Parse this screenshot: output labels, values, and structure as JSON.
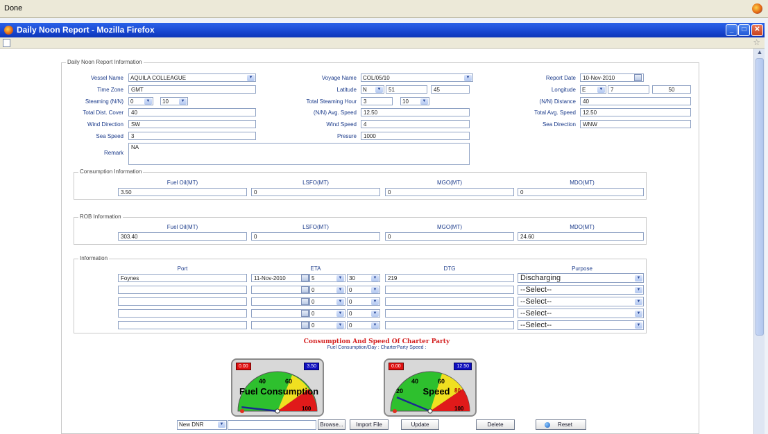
{
  "status": {
    "text": "Done"
  },
  "window": {
    "title": "Daily Noon Report - Mozilla Firefox"
  },
  "form": {
    "section_title": "Daily Noon Report Information",
    "vessel_name": {
      "label": "Vessel Name",
      "value": "AQUILA COLLEAGUE"
    },
    "voyage_name": {
      "label": "Voyage Name",
      "value": "COL/05/10"
    },
    "report_date": {
      "label": "Report Date",
      "value": "10-Nov-2010"
    },
    "time_zone": {
      "label": "Time Zone",
      "value": "GMT"
    },
    "latitude": {
      "label": "Latitude",
      "dir": "N",
      "deg": "51",
      "min": "45"
    },
    "longitude": {
      "label": "Longitude",
      "dir": "E",
      "deg": "7",
      "min": "50"
    },
    "steaming": {
      "label": "Steaming (N/N)",
      "h": "0",
      "m": "10"
    },
    "total_steaming_hour": {
      "label": "Total Steaming Hour",
      "h": "3",
      "m": "10"
    },
    "nn_distance": {
      "label": "(N/N) Distance",
      "value": "40"
    },
    "total_dist_cover": {
      "label": "Total Dist. Cover",
      "value": "40"
    },
    "nn_avg_speed": {
      "label": "(N/N) Avg. Speed",
      "value": "12.50"
    },
    "total_avg_speed": {
      "label": "Total Avg. Speed",
      "value": "12.50"
    },
    "wind_direction": {
      "label": "Wind Direction",
      "value": "SW"
    },
    "wind_speed": {
      "label": "Wind Speed",
      "value": "4"
    },
    "sea_direction": {
      "label": "Sea Direction",
      "value": "WNW"
    },
    "sea_speed": {
      "label": "Sea Speed",
      "value": "3"
    },
    "presure": {
      "label": "Presure",
      "value": "1000"
    },
    "remark": {
      "label": "Remark",
      "value": "NA"
    }
  },
  "consumption": {
    "legend": "Consumption Information",
    "cols": [
      "Fuel Oil(MT)",
      "LSFO(MT)",
      "MGO(MT)",
      "MDO(MT)"
    ],
    "values": [
      "3.50",
      "0",
      "0",
      "0"
    ]
  },
  "rob": {
    "legend": "ROB Information",
    "cols": [
      "Fuel Oil(MT)",
      "LSFO(MT)",
      "MGO(MT)",
      "MDO(MT)"
    ],
    "values": [
      "303.40",
      "0",
      "0",
      "24.60"
    ]
  },
  "info": {
    "legend": "Information",
    "cols": [
      "Port",
      "ETA",
      "DTG",
      "Purpose"
    ],
    "rows": [
      {
        "port": "Foynes",
        "date": "11-Nov-2010",
        "h": "5",
        "m": "30",
        "dtg": "219",
        "purpose": "Discharging"
      },
      {
        "port": "",
        "date": "",
        "h": "0",
        "m": "0",
        "dtg": "",
        "purpose": "--Select--"
      },
      {
        "port": "",
        "date": "",
        "h": "0",
        "m": "0",
        "dtg": "",
        "purpose": "--Select--"
      },
      {
        "port": "",
        "date": "",
        "h": "0",
        "m": "0",
        "dtg": "",
        "purpose": "--Select--"
      },
      {
        "port": "",
        "date": "",
        "h": "0",
        "m": "0",
        "dtg": "",
        "purpose": "--Select--"
      }
    ]
  },
  "charter": {
    "title": "Consumption And Speed Of Charter Party",
    "subtitle": "Fuel Consumption/Day :   CharterParty Speed :",
    "gauges": [
      {
        "label": "Fuel Consumption",
        "low": "0.00",
        "high": "3.50",
        "t40": "40",
        "t60": "60",
        "t100": "100",
        "level": 0.035
      },
      {
        "label": "Speed",
        "low": "0.00",
        "high": "12.50",
        "t20": "20",
        "t40": "40",
        "t60": "60",
        "t80": "80",
        "t100": "100",
        "level": 0.125
      }
    ]
  },
  "bottom": {
    "select": "New DNR",
    "browse": "Browse...",
    "import": "Import File",
    "update": "Update",
    "delete": "Delete",
    "reset": "Reset"
  }
}
